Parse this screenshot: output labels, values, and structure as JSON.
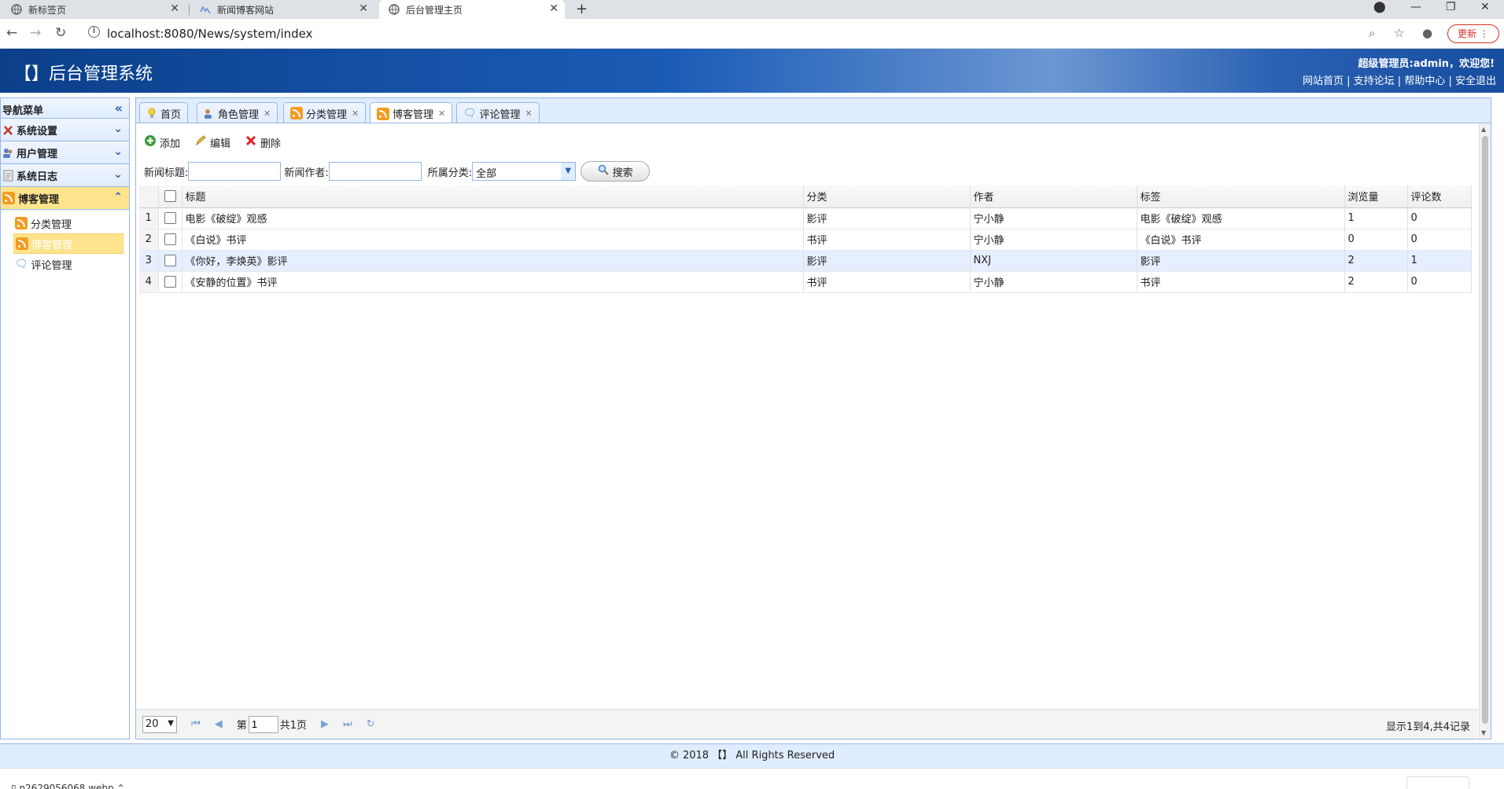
{
  "browser": {
    "tabs": [
      {
        "label": "新标签页",
        "active": false
      },
      {
        "label": "新闻博客网站",
        "active": false
      },
      {
        "label": "后台管理主页",
        "active": true
      }
    ],
    "url": "localhost:8080/News/system/index",
    "update_label": "更新"
  },
  "header": {
    "title": "【】后台管理系统",
    "welcome": "超级管理员:admin，欢迎您!",
    "links": [
      "网站首页",
      "支持论坛",
      "帮助中心",
      "安全退出"
    ]
  },
  "sidebar": {
    "title": "导航菜单",
    "sections": [
      {
        "label": "系统设置"
      },
      {
        "label": "用户管理"
      },
      {
        "label": "系统日志"
      },
      {
        "label": "博客管理"
      }
    ],
    "tree": [
      {
        "label": "分类管理"
      },
      {
        "label": "博客管理"
      },
      {
        "label": "评论管理"
      }
    ]
  },
  "panel_tabs": [
    {
      "label": "首页"
    },
    {
      "label": "角色管理"
    },
    {
      "label": "分类管理"
    },
    {
      "label": "博客管理"
    },
    {
      "label": "评论管理"
    }
  ],
  "toolbar": {
    "add": "添加",
    "edit": "编辑",
    "delete": "删除"
  },
  "search": {
    "title_label": "新闻标题:",
    "title_value": "",
    "author_label": "新闻作者:",
    "author_value": "",
    "category_label": "所属分类:",
    "category_value": "全部",
    "search_button": "搜索"
  },
  "grid": {
    "columns": [
      "标题",
      "分类",
      "作者",
      "标签",
      "浏览量",
      "评论数"
    ],
    "rows": [
      {
        "num": "1",
        "title": "电影《破绽》观感",
        "category": "影评",
        "author": "宁小静",
        "tags": "电影《破绽》观感",
        "views": "1",
        "comments": "0"
      },
      {
        "num": "2",
        "title": "《白说》书评",
        "category": "书评",
        "author": "宁小静",
        "tags": "《白说》书评",
        "views": "0",
        "comments": "0"
      },
      {
        "num": "3",
        "title": "《你好，李焕英》影评",
        "category": "影评",
        "author": "NXJ",
        "tags": "影评",
        "views": "2",
        "comments": "1"
      },
      {
        "num": "4",
        "title": "《安静的位置》书评",
        "category": "书评",
        "author": "宁小静",
        "tags": "书评",
        "views": "2",
        "comments": "0"
      }
    ]
  },
  "pager": {
    "page_size": "20",
    "page_prefix": "第",
    "page_value": "1",
    "page_total": "共1页",
    "info": "显示1到4,共4记录"
  },
  "footer": {
    "copyright": "© 2018 【】 All Rights Reserved"
  },
  "download": {
    "filename": "n2629056068.webp"
  }
}
